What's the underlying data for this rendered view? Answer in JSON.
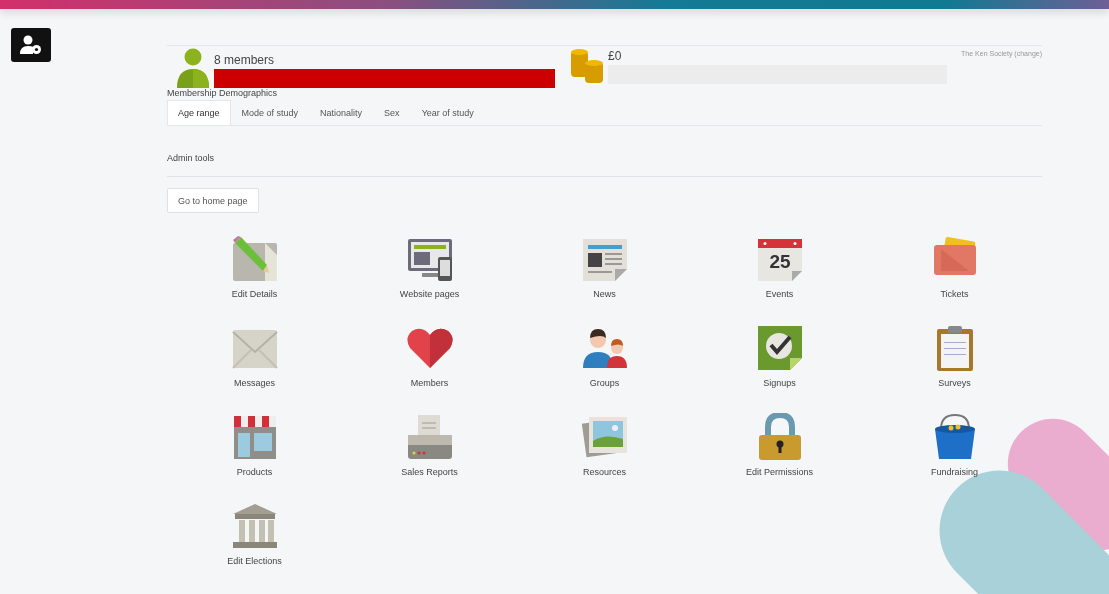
{
  "members": {
    "count": "8 members",
    "level": 1
  },
  "funds": {
    "amount": "£0",
    "level": 0
  },
  "society_link": "The Ken Society (change)",
  "demographics": {
    "title": "Membership Demographics",
    "tabs": [
      {
        "label": "Age range",
        "selected": true
      },
      {
        "label": "Mode of study",
        "selected": false
      },
      {
        "label": "Nationality",
        "selected": false
      },
      {
        "label": "Sex",
        "selected": false
      },
      {
        "label": "Year of study",
        "selected": false
      }
    ]
  },
  "admin_tools": {
    "title": "Admin tools",
    "home_button": "Go to home page",
    "tools": [
      {
        "label": "Edit Details",
        "kind": "pencil"
      },
      {
        "label": "Website pages",
        "kind": "devices"
      },
      {
        "label": "News",
        "kind": "newspaper"
      },
      {
        "label": "Events",
        "kind": "calendar",
        "icon_text": "25"
      },
      {
        "label": "Tickets",
        "kind": "tickets"
      },
      {
        "label": "Messages",
        "kind": "envelope"
      },
      {
        "label": "Members",
        "kind": "heart"
      },
      {
        "label": "Groups",
        "kind": "people"
      },
      {
        "label": "Signups",
        "kind": "check"
      },
      {
        "label": "Surveys",
        "kind": "clipboard"
      },
      {
        "label": "Products",
        "kind": "shop"
      },
      {
        "label": "Sales Reports",
        "kind": "printer"
      },
      {
        "label": "Resources",
        "kind": "photos"
      },
      {
        "label": "Edit Permissions",
        "kind": "padlock"
      },
      {
        "label": "Fundraising",
        "kind": "bucket"
      },
      {
        "label": "Edit Elections",
        "kind": "building"
      }
    ]
  }
}
